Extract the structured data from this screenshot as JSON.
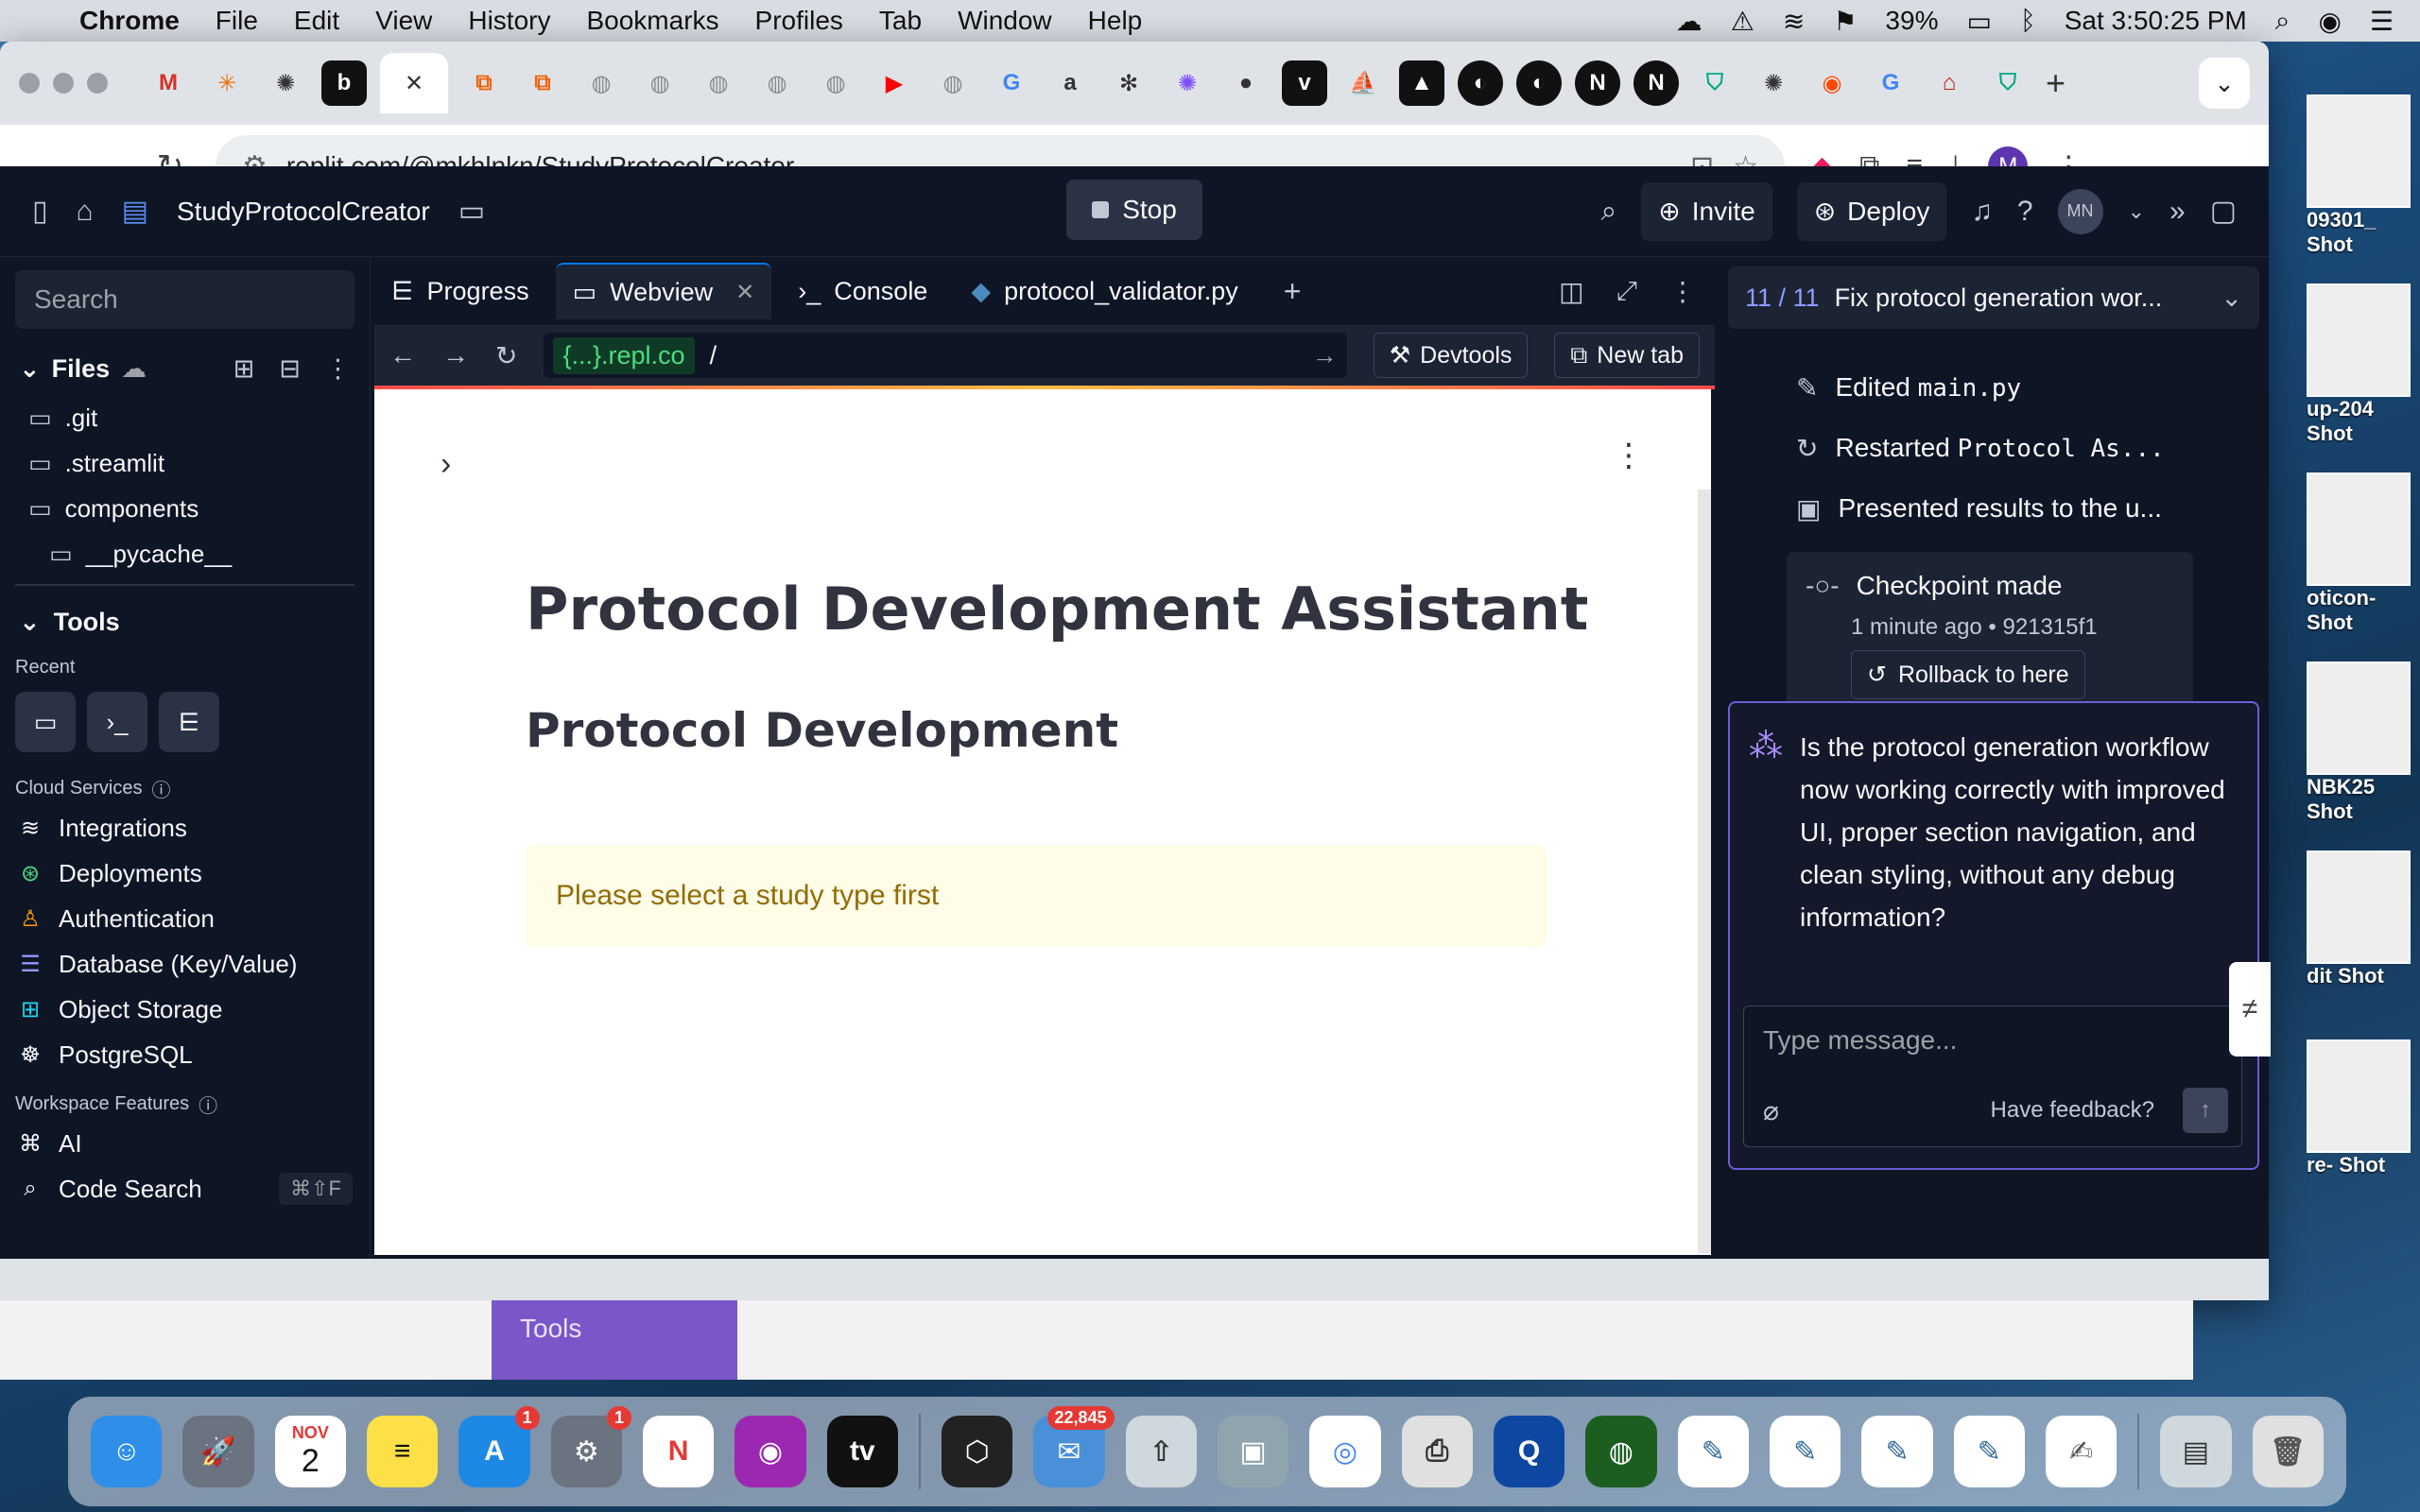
{
  "menubar": {
    "app_name": "Chrome",
    "items": [
      "File",
      "Edit",
      "View",
      "History",
      "Bookmarks",
      "Profiles",
      "Tab",
      "Window",
      "Help"
    ],
    "battery": "39%",
    "clock": "Sat 3:50:25 PM"
  },
  "browser": {
    "url": "replit.com/@mkhlnkn/StudyProtocolCreator",
    "profile_initial": "M"
  },
  "replit": {
    "project_name": "StudyProtocolCreator",
    "stop_label": "Stop",
    "invite_label": "Invite",
    "deploy_label": "Deploy",
    "avatar_initials": "MN",
    "sidebar": {
      "search_placeholder": "Search",
      "files_label": "Files",
      "files": [
        ".git",
        ".streamlit",
        "components",
        "__pycache__"
      ],
      "tools_label": "Tools",
      "recent_label": "Recent",
      "cloud_services_label": "Cloud Services",
      "services": [
        "Integrations",
        "Deployments",
        "Authentication",
        "Database (Key/Value)",
        "Object Storage",
        "PostgreSQL"
      ],
      "workspace_features_label": "Workspace Features",
      "features": [
        "AI",
        "Code Search"
      ],
      "code_search_shortcut": "⌘⇧F"
    },
    "pane_tabs": [
      "Progress",
      "Webview",
      "Console",
      "protocol_validator.py"
    ],
    "webview": {
      "host": "{...}.repl.co",
      "path": "/",
      "devtools_label": "Devtools",
      "newtab_label": "New tab",
      "title": "Protocol Development Assistant",
      "subtitle": "Protocol Development",
      "warning": "Please select a study type first"
    },
    "agent": {
      "step_count": "11 / 11",
      "task_title": "Fix protocol generation wor...",
      "actions": [
        {
          "prefix": "Edited ",
          "mono": "main.py"
        },
        {
          "prefix": "Restarted ",
          "mono": "Protocol As..."
        },
        {
          "prefix": "Presented results to the u...",
          "mono": ""
        }
      ],
      "checkpoint_title": "Checkpoint made",
      "checkpoint_meta": "1 minute ago • 921315f1",
      "rollback_label": "Rollback to here",
      "message": "Is the protocol generation workflow now working correctly with improved UI, proper section navigation, and clean styling, without any debug information?",
      "composer_placeholder": "Type message...",
      "feedback_label": "Have feedback?"
    }
  },
  "behind_page": {
    "tools_label": "Tools"
  },
  "desktop_labels": [
    "09301_ Shot",
    "up-204 Shot",
    "oticon- Shot",
    "NBK25 Shot",
    "dit Shot",
    "re- Shot"
  ],
  "dock": {
    "calendar_month": "NOV",
    "calendar_day": "2",
    "appstore_badge": "1",
    "settings_badge": "1",
    "mail_badge": "22,845"
  }
}
